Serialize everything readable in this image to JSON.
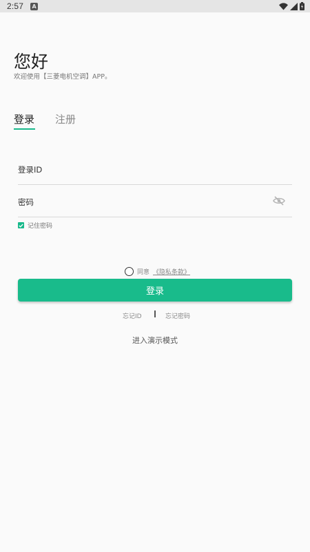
{
  "status_bar": {
    "time": "2:57",
    "notification_badge": "A"
  },
  "greeting": {
    "title": "您好",
    "subtitle": "欢迎使用【三菱电机空调】APP。"
  },
  "tabs": [
    {
      "label": "登录",
      "active": true
    },
    {
      "label": "注册",
      "active": false
    }
  ],
  "form": {
    "login_id_label": "登录ID",
    "password_label": "密码",
    "remember_label": "记住密码",
    "remember_checked": true
  },
  "agreement": {
    "prefix": "同意",
    "link": "《隐私条款》",
    "checked": false
  },
  "login_button_label": "登录",
  "links": {
    "forgot_id": "忘记ID",
    "divider": "I",
    "forgot_password": "忘记密码",
    "demo_mode": "进入演示模式"
  },
  "colors": {
    "accent": "#19bb8b",
    "background": "#fafafa",
    "status_bar": "#e5e5e5"
  },
  "icons": {
    "password_visibility": "eye-off-icon",
    "wifi": "wifi-icon",
    "signal": "signal-icon",
    "battery": "battery-icon"
  }
}
